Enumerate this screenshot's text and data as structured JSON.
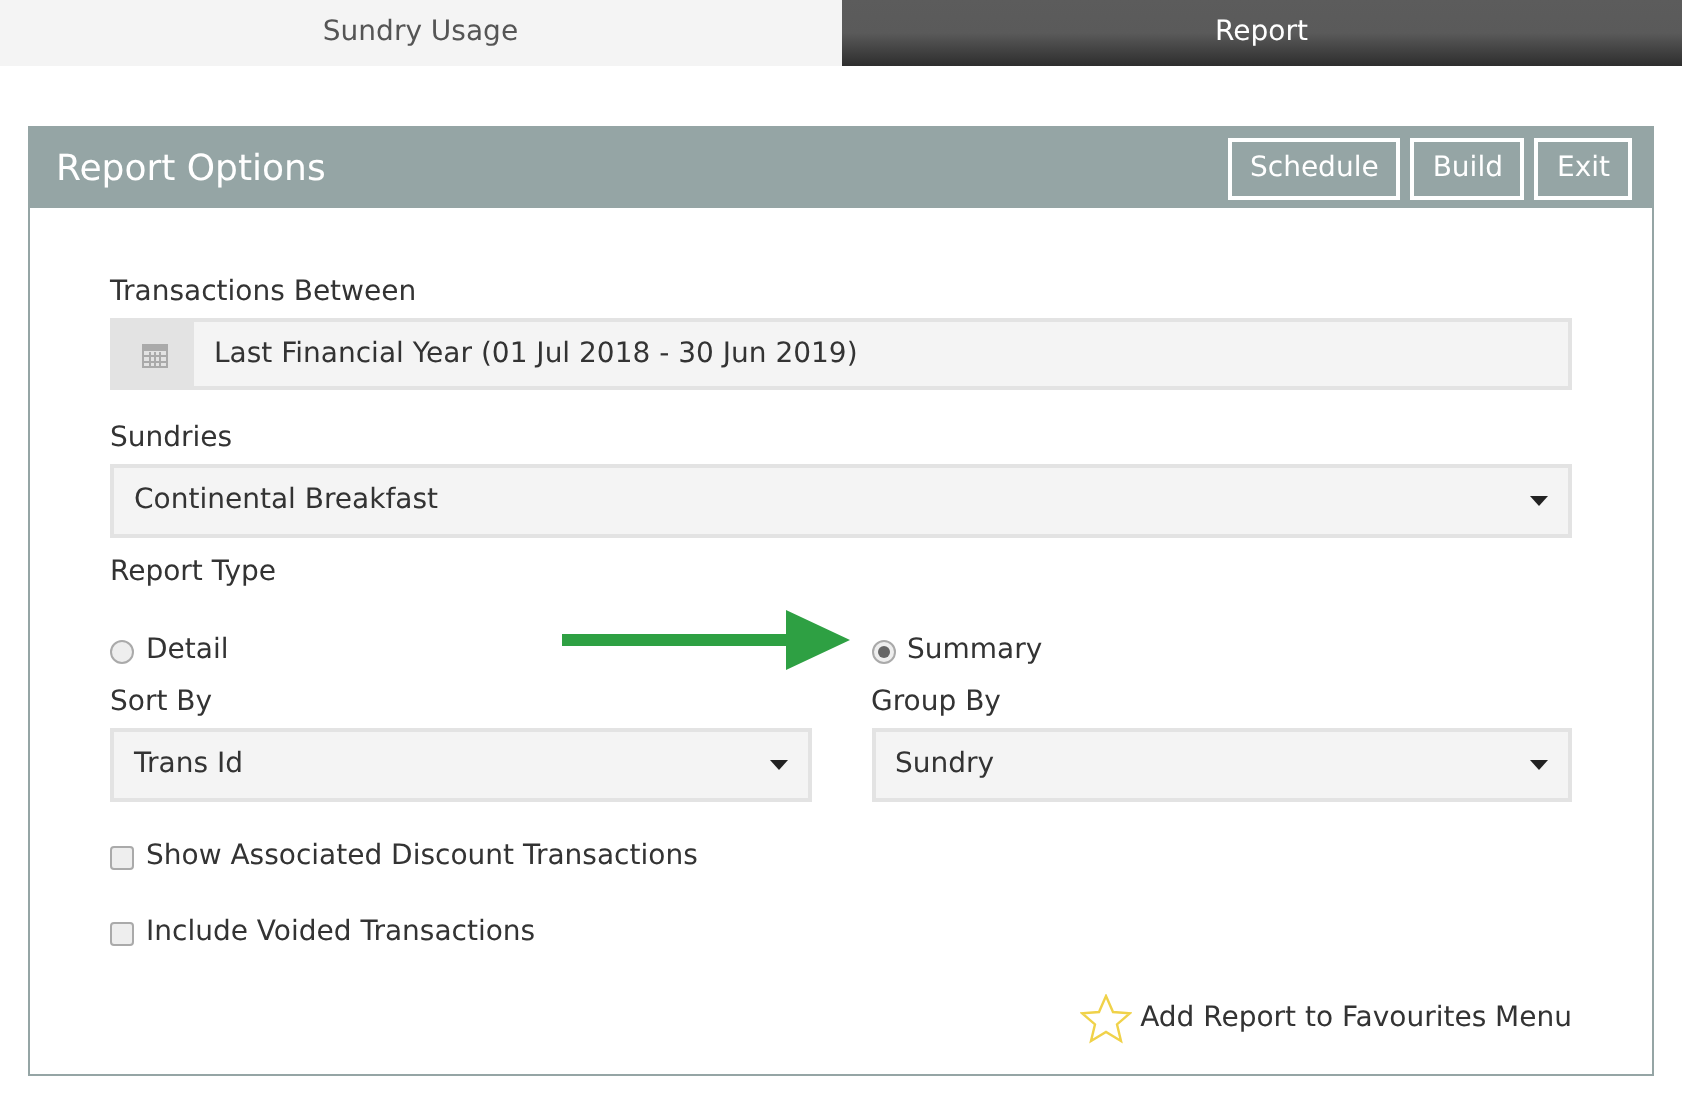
{
  "tabs": [
    {
      "label": "Sundry Usage",
      "selected": false
    },
    {
      "label": "Report",
      "selected": true
    }
  ],
  "panel": {
    "title": "Report Options",
    "buttons": [
      "Schedule",
      "Build",
      "Exit"
    ]
  },
  "transactions_between": {
    "label": "Transactions Between",
    "value": "Last Financial Year (01 Jul 2018 - 30 Jun 2019)"
  },
  "sundries": {
    "label": "Sundries",
    "value": "Continental Breakfast"
  },
  "report_type": {
    "label": "Report Type",
    "options": [
      {
        "label": "Detail",
        "selected": false
      },
      {
        "label": "Summary",
        "selected": true
      }
    ]
  },
  "sort_by": {
    "label": "Sort By",
    "value": "Trans Id"
  },
  "group_by": {
    "label": "Group By",
    "value": "Sundry"
  },
  "checkboxes": [
    {
      "label": "Show Associated Discount Transactions",
      "checked": false
    },
    {
      "label": "Include Voided Transactions",
      "checked": false
    }
  ],
  "favourites_link": "Add Report to Favourites Menu"
}
